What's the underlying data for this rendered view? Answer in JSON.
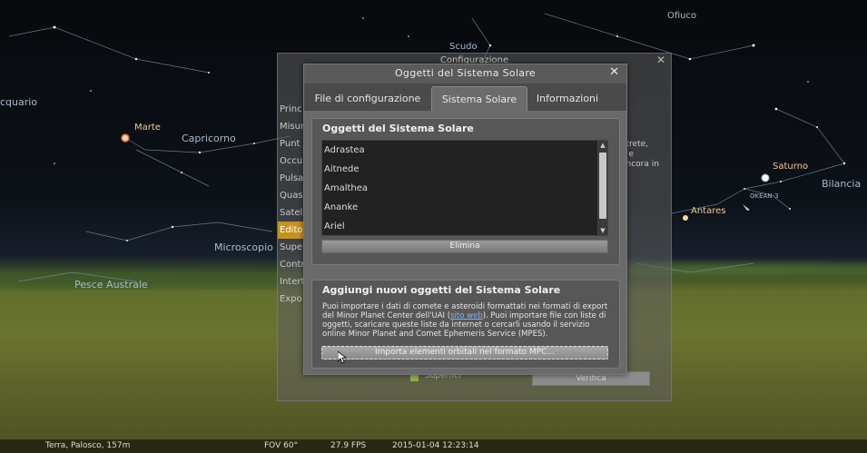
{
  "sky": {
    "labels": [
      "Scudo",
      "Ofiuco",
      "Capricorno",
      "Microscopio",
      "Pesce Australe",
      "Bilancia",
      "cquario"
    ],
    "planets": [
      "Marte",
      "Saturno",
      "Antares"
    ],
    "small_label": "OKEAN-3"
  },
  "background_config": {
    "title": "Configurazione",
    "close": "✕",
    "sidebar": [
      "Princ",
      "Misur",
      "Punt",
      "Occul",
      "Pulsa",
      "Quas",
      "Satell",
      "Editor",
      "Super",
      "Contr",
      "Intert",
      "Expo"
    ],
    "active_index": 7,
    "right_text": [
      "otrete,",
      "a e",
      "ancora in"
    ],
    "checkbox_label": "Superfici",
    "button_label": "Verifica"
  },
  "dialog": {
    "title": "Oggetti del Sistema Solare",
    "close": "✕",
    "tabs": [
      "File di configurazione",
      "Sistema Solare",
      "Informazioni"
    ],
    "active_tab": 1,
    "objects_group": {
      "title": "Oggetti del Sistema Solare",
      "items": [
        "Adrastea",
        "Aitnede",
        "Amalthea",
        "Ananke",
        "Ariel"
      ],
      "delete_label": "Elimina"
    },
    "import_group": {
      "title": "Aggiungi nuovi oggetti del Sistema Solare",
      "text_before_link": "Puoi importare i dati di comete e asteroidi formattati nei formati di export del Minor Planet Center dell'UAI (",
      "link": "sito web",
      "text_after_link": "). Puoi importare file con liste di oggetti, scaricare queste liste da internet o cercarli usando il servizio online Minor Planet and Comet Ephemeris Service (MPES).",
      "import_label": "Importa elementi orbitali nel formato MPC..."
    }
  },
  "status_bar": {
    "location": "Terra, Palosco, 157m",
    "fov": "FOV 60°",
    "fps": "27.9 FPS",
    "datetime": "2015-01-04 12:23:14"
  },
  "colors": {
    "accent": "#c8921e",
    "link": "#7fb2ff"
  }
}
